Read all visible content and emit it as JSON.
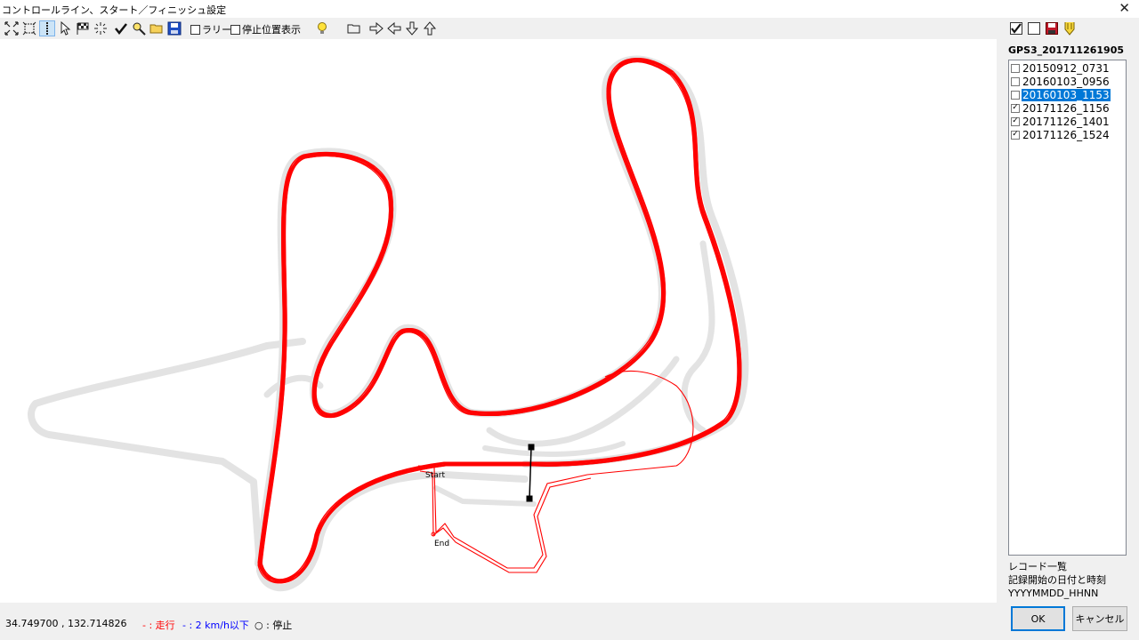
{
  "window": {
    "title": "コントロールライン、スタート／フィニッシュ設定",
    "close_glyph": "✕"
  },
  "toolbar": {
    "rally_label": "ラリー",
    "stop_position_label": "停止位置表示"
  },
  "map": {
    "start_label": "Start",
    "end_label": "End",
    "track_color": "#e3e3e3",
    "trace_color": "#ff0000"
  },
  "status": {
    "coordinates": "34.749700 , 132.714826",
    "legend_running": "- : 走行",
    "legend_slow": "- : 2 km/h以下",
    "legend_stop": "○ : 停止",
    "running_color": "#ff0000",
    "slow_color": "#0000ff"
  },
  "right_panel": {
    "gps_label": "GPS3_201711261905",
    "records": [
      {
        "label": "20150912_0731",
        "checked": false,
        "selected": false
      },
      {
        "label": "20160103_0956",
        "checked": false,
        "selected": false
      },
      {
        "label": "20160103_1153",
        "checked": false,
        "selected": true
      },
      {
        "label": "20171126_1156",
        "checked": true,
        "selected": false
      },
      {
        "label": "20171126_1401",
        "checked": true,
        "selected": false
      },
      {
        "label": "20171126_1524",
        "checked": true,
        "selected": false
      }
    ],
    "info_line1": "レコード一覧",
    "info_line2": "記録開始の日付と時刻",
    "info_line3": "YYYYMMDD_HHNN",
    "ok_label": "OK",
    "cancel_label": "キャンセル"
  }
}
